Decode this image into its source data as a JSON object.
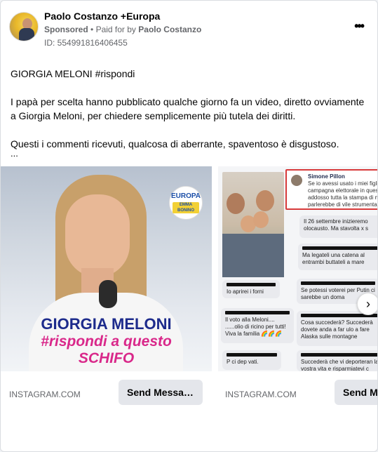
{
  "post": {
    "page_name": "Paolo Costanzo +Europa",
    "sponsored_label": "Sponsored",
    "paid_for_prefix": "Paid for by",
    "paid_for_name": "Paolo Costanzo",
    "ad_id": "ID: 554991816406455",
    "more_icon": "more-horizontal-icon",
    "paragraphs": [
      "GIORGIA MELONI #rispondi",
      "I papà per scelta hanno pubblicato qualche giorno fa un video, diretto ovviamente a Giorgia Meloni, per chiedere semplicemente più tutela dei diritti.",
      "Questi i commenti ricevuti, qualcosa di aberrante, spaventoso è disgustoso."
    ],
    "ellipsis": "..."
  },
  "carousel": {
    "slides": [
      {
        "badge_line1": "EUROPA",
        "badge_line2": "EMMA BONINO",
        "title_line1": "GIORGIA MELONI",
        "title_line2": "#rispondi a questo",
        "title_line3": "SCHIFO",
        "domain": "INSTAGRAM.COM",
        "cta": "Send Messa…"
      },
      {
        "pillon_name": "Simone Pillon",
        "pillon_text": "Se io avessi usato i miei figli campagna elettorale in ques addosso tutta la stampa di n parlerebbe di vile strumenta",
        "comments": [
          "Il 26 settembre inizieremo olocausto. Ma stavolta x s",
          "Io aprirei i forni",
          "Ma legateli una catena al entrambi buttateli a mare",
          "Se potessi voterei per Putin ci sarebbe un doma",
          "Il voto alla Meloni.... ......olio di ricino per tutti! Viva la familia 🌈🌈🌈",
          "Cosa succederà? Succederà dovete anda a far ulo a fare Alaska sulle montagne",
          "P ci dep vati.",
          "Succederà che vi deporteran la vostra vita e risparmiatevi c"
        ],
        "domain": "INSTAGRAM.COM",
        "cta": "Send M"
      }
    ],
    "next_icon": "chevron-right-icon"
  }
}
